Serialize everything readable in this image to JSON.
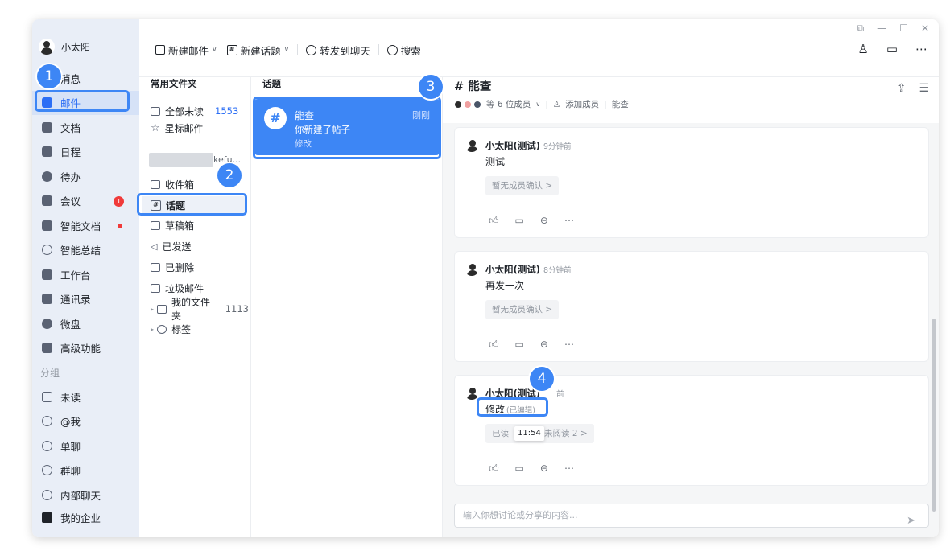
{
  "user": {
    "name": "小太阳"
  },
  "nav": {
    "items": [
      {
        "label": "消息"
      },
      {
        "label": "邮件"
      },
      {
        "label": "文档"
      },
      {
        "label": "日程"
      },
      {
        "label": "待办"
      },
      {
        "label": "会议",
        "badge": "1"
      },
      {
        "label": "智能文档"
      },
      {
        "label": "智能总结"
      },
      {
        "label": "工作台"
      },
      {
        "label": "通讯录"
      },
      {
        "label": "微盘"
      },
      {
        "label": "高级功能"
      }
    ],
    "group_title": "分组",
    "group_items": [
      {
        "label": "未读"
      },
      {
        "label": "@我"
      },
      {
        "label": "单聊"
      },
      {
        "label": "群聊"
      },
      {
        "label": "内部聊天"
      }
    ],
    "bottom": "我的企业"
  },
  "toolbar": {
    "new_mail": "新建邮件",
    "new_topic": "新建话题",
    "forward_chat": "转发到聊天",
    "search": "搜索"
  },
  "folders": {
    "header": "常用文件夹",
    "all_unread": "全部未读",
    "all_unread_count": "1553",
    "starred": "星标邮件",
    "account_suffix": "kefu...",
    "inbox": "收件箱",
    "topics": "话题",
    "drafts": "草稿箱",
    "sent": "已发送",
    "deleted": "已删除",
    "spam": "垃圾邮件",
    "my_folders": "我的文件夹",
    "my_folders_count": "1113",
    "tags": "标签"
  },
  "topics": {
    "header": "话题",
    "card": {
      "icon": "#",
      "title": "能查",
      "subtitle": "你新建了帖子",
      "edit": "修改",
      "time": "刚刚"
    }
  },
  "chat": {
    "title": "# 能查",
    "members": "等 6 位成员",
    "add_member": "添加成员",
    "tag": "能查",
    "messages": [
      {
        "author": "小太阳(测试)",
        "time": "9分钟前",
        "text": "测试",
        "chip": "暂无成员确认 >"
      },
      {
        "author": "小太阳(测试)",
        "time": "8分钟前",
        "text": "再发一次",
        "chip": "暂无成员确认 >"
      },
      {
        "author": "小太阳(测试)",
        "time": "前",
        "text": "修改",
        "edited": "(已编辑)",
        "chip_left": "已读",
        "chip_right": "未阅读 2 >",
        "tooltip": "11:54"
      }
    ],
    "input_placeholder": "输入你想讨论或分享的内容..."
  },
  "callouts": [
    "1",
    "2",
    "3",
    "4"
  ]
}
